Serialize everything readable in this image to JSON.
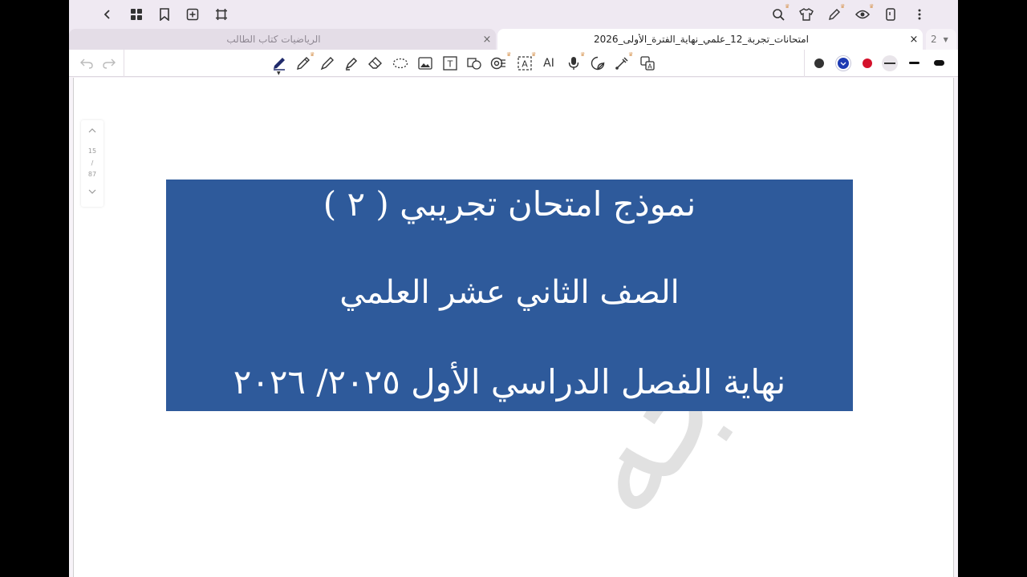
{
  "topbar": {
    "left_icons": [
      "back-icon",
      "grid-icon",
      "bookmark-icon",
      "add-page-icon",
      "crop-icon"
    ],
    "right_icons": [
      "search-icon",
      "tshirt-icon",
      "pen-edit-icon",
      "eye-icon",
      "phone-icon",
      "more-icon"
    ]
  },
  "tabs": {
    "inactive_title": "الرياضيات كتاب الطالب",
    "active_title": "امتحانات_تجربة_12_علمي_نهاية_الفترة_الأولى_2026",
    "close_glyph": "×",
    "count": "2"
  },
  "toolbar": {
    "ai_label": "AI",
    "text_tool_label": "T",
    "colors": [
      "#333333",
      "#1e3bb3",
      "#d4112b"
    ],
    "accent_star": "#d99a5b"
  },
  "pager": {
    "current": "15",
    "divider": "/",
    "total": "87"
  },
  "banner": {
    "line1": "نموذج امتحان تجريبي ( ٢ )",
    "line2": "الصف الثاني  عشر العلمي",
    "line3": "نهاية الفصل الدراسي الأول ٢٠٢٥/ ٢٠٢٦",
    "background": "#2e5a9b"
  },
  "watermark": {
    "text": "موجه"
  }
}
